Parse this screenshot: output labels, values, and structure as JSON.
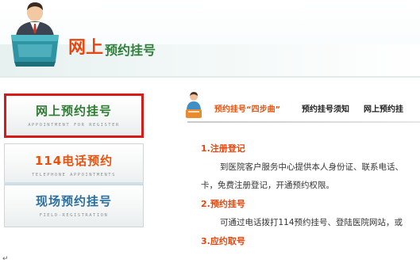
{
  "header": {
    "title_main": "网上",
    "title_sub": "预约挂号"
  },
  "nav": [
    {
      "label": "网上预约挂号",
      "sub": "APPOINTMENT FOR REGISTER",
      "color": "#2e7c33",
      "selected": true
    },
    {
      "label": "114电话预约",
      "sub": "TELEPHONE APPOINTMENTS",
      "color": "#e8530f"
    },
    {
      "label": "现场预约挂号",
      "sub": "FIELD-REGISTRATION",
      "color": "#2c6e9e"
    }
  ],
  "tabs": [
    {
      "label": "预约挂号“四步曲”",
      "active": true
    },
    {
      "label": "预约挂号须知"
    },
    {
      "label": "网上预约挂"
    }
  ],
  "steps": [
    {
      "heading": "1.注册登记",
      "lines": [
        "到医院客户服务中心提供本人身份证、联系电话、",
        "卡，免费注册登记，开通预约权限。"
      ]
    },
    {
      "heading": "2.预约挂号",
      "lines": [
        "可通过电话拨打114预约挂号、登陆医院网站，或"
      ]
    },
    {
      "heading": "3.应约取号",
      "lines": []
    }
  ],
  "footer_mark": "↵",
  "colors": {
    "accent_orange": "#e8460d",
    "accent_green": "#2e7c33",
    "selection_border": "#d61b1b"
  }
}
